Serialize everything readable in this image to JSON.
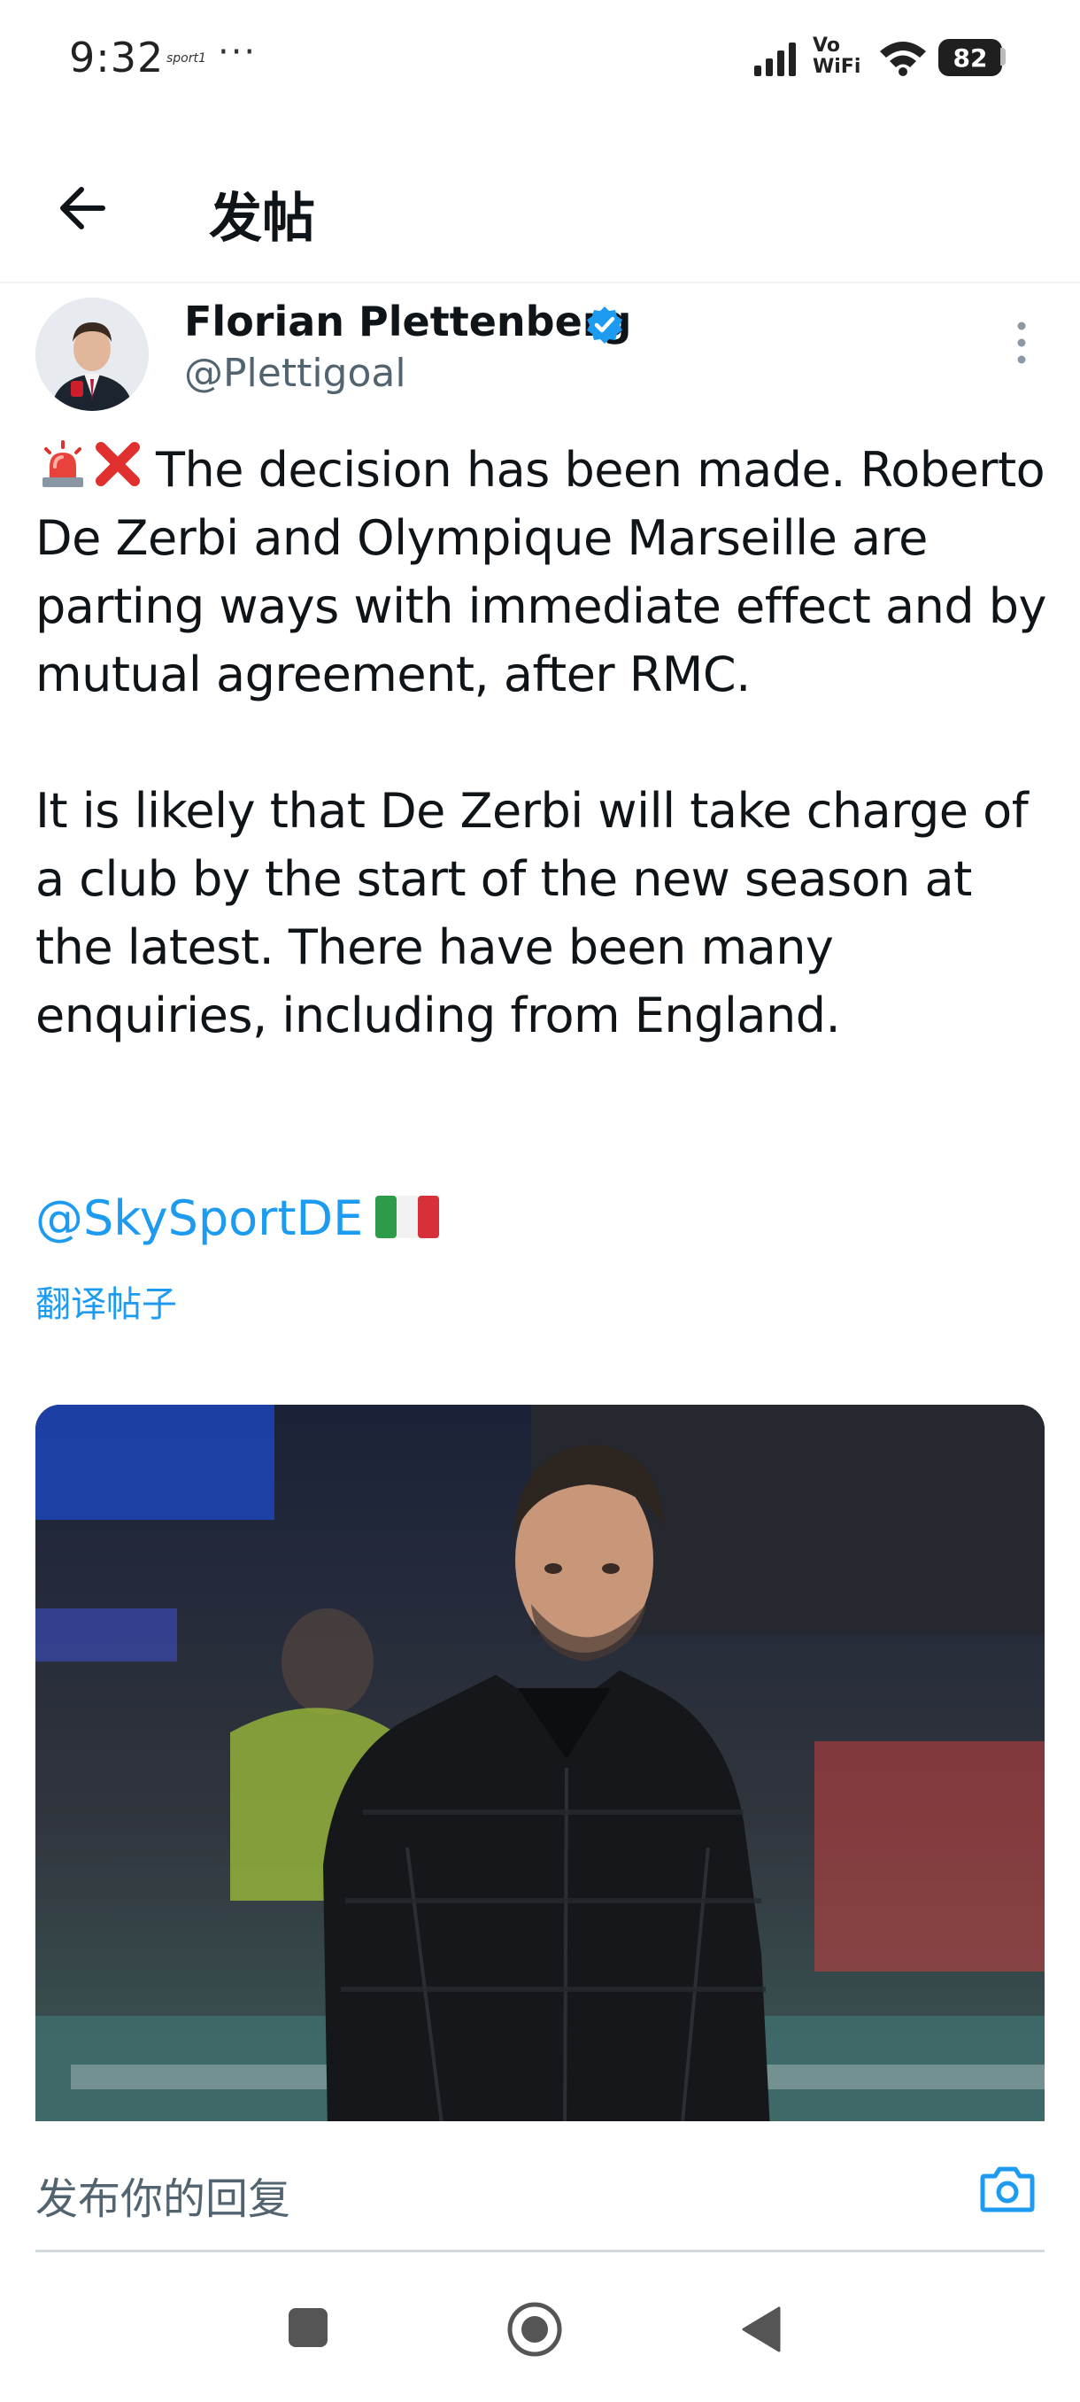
{
  "status_bar": {
    "time": "9:32",
    "app_label": "sport1",
    "more": "···",
    "network_label": "Vo WiFi",
    "battery": "82"
  },
  "header": {
    "back_icon": "arrow-left-icon",
    "title": "发帖"
  },
  "tweet": {
    "author": {
      "name": "Florian Plettenberg",
      "handle": "@Plettigoal",
      "verified": true
    },
    "text": "The decision has been made. Roberto De Zerbi and Olympique Marseille are parting ways with immediate effect and by mutual agreement, after RMC.\n\nIt is likely that De Zerbi will take charge of a club by the start of the new season at the latest. There have been many enquiries, including from England.",
    "mention": "@SkySportDE",
    "translate_label": "翻译帖子",
    "emojis": [
      "siren-icon",
      "cross-mark-icon",
      "italy-flag-icon"
    ]
  },
  "reply": {
    "placeholder": "发布你的回复",
    "camera_icon": "camera-icon"
  },
  "nav": {
    "recents_icon": "square-icon",
    "home_icon": "circle-icon",
    "back_icon": "triangle-back-icon"
  },
  "colors": {
    "accent": "#1d9bf0",
    "text": "#0f1419",
    "secondary": "#536471",
    "divider": "#cfd9de"
  }
}
